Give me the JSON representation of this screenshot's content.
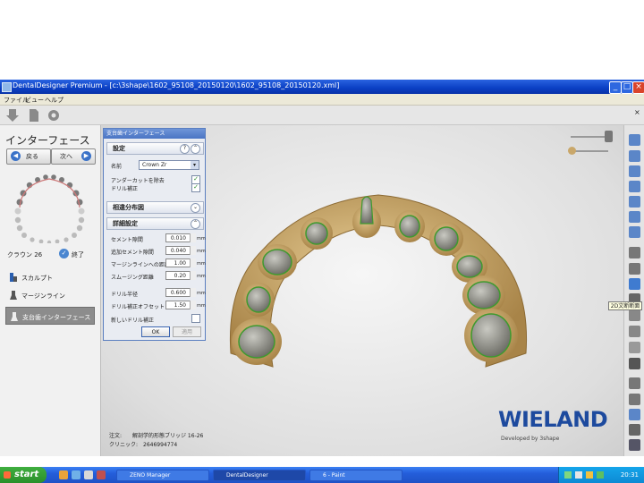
{
  "window": {
    "title": "DentalDesigner Premium - [c:\\3shape\\1602_95108_20150120\\1602_95108_20150120.xml]"
  },
  "menu": [
    "ファイル",
    "ビュー",
    "ヘルプ"
  ],
  "left_panel": {
    "title": "インターフェース",
    "back_label": "戻る",
    "next_label": "次へ",
    "crown_label": "クラウン 26",
    "finish_label": "終了",
    "tools": [
      {
        "label": "スカルプト"
      },
      {
        "label": "マージンライン"
      },
      {
        "label": "支台歯インターフェース"
      }
    ]
  },
  "dialog": {
    "title": "支台歯インターフェース",
    "settings": {
      "header": "設定",
      "help": "?",
      "name_label": "名前",
      "name_value": "Crown Zr",
      "undercut_label": "アンダーカットを除去",
      "undercut_checked": true,
      "drill_label": "ドリル補正",
      "drill_checked": true
    },
    "distribution_header": "相違分布図",
    "detail": {
      "header": "詳細設定",
      "rows": [
        {
          "label": "セメント隙間",
          "value": "0.010",
          "unit": "mm"
        },
        {
          "label": "追加セメント隙間",
          "value": "0.040",
          "unit": "mm"
        },
        {
          "label": "マージンラインへの距離",
          "value": "1.00",
          "unit": "mm"
        },
        {
          "label": "スムージング距離",
          "value": "0.20",
          "unit": "mm"
        },
        {
          "label": "ドリル半径",
          "value": "0.600",
          "unit": "mm"
        },
        {
          "label": "ドリル補正オフセット",
          "value": "1.50",
          "unit": "mm"
        }
      ],
      "new_drill_label": "新しいドリル補正",
      "new_drill_checked": false
    },
    "ok_label": "OK",
    "apply_label": "適用"
  },
  "footer": {
    "order": "注文:　　解剖学的形態ブリッジ 16-26",
    "clinic": "クリニック:　2646994774"
  },
  "brand": {
    "name": "WIELAND",
    "sub": "Developed by 3shape",
    "color": "#1d4a9e"
  },
  "tooltip": "2D文断断面",
  "taskbar": {
    "start": "start",
    "tasks": [
      "ZENO Manager",
      "DentalDesigner",
      "6 - Paint"
    ],
    "clock": "20:31"
  },
  "colors": {
    "tooth": "#c9a76a",
    "prep": "#8f8f86",
    "margin": "#3f9a2f"
  }
}
